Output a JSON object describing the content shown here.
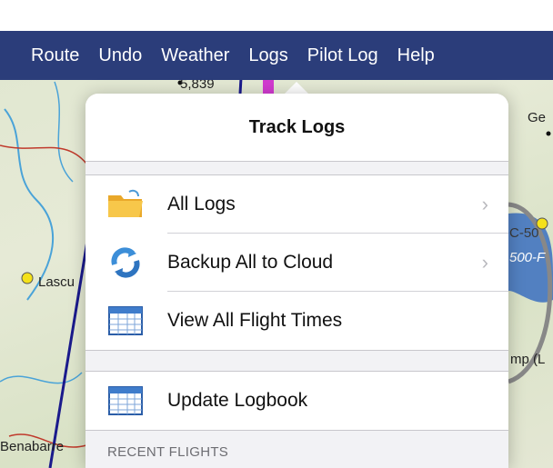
{
  "toolbar": {
    "items": [
      "Route",
      "Undo",
      "Weather",
      "Logs",
      "Pilot Log",
      "Help"
    ]
  },
  "map": {
    "labels": {
      "elevation": "5,839",
      "lascu": "Lascu",
      "benabarre": "Benabarre",
      "ge": "Ge",
      "c50": "C-50",
      "f500": "500-F",
      "mp": "mp (L"
    }
  },
  "popover": {
    "title": "Track Logs",
    "items": [
      {
        "label": "All Logs",
        "icon": "folder-icon",
        "chevron": "›"
      },
      {
        "label": "Backup All to Cloud",
        "icon": "cloud-sync-icon",
        "chevron": "›"
      },
      {
        "label": "View All Flight Times",
        "icon": "table-icon",
        "chevron": ""
      }
    ],
    "items2": [
      {
        "label": "Update Logbook",
        "icon": "table-icon"
      }
    ],
    "section_header": "RECENT FLIGHTS"
  },
  "colors": {
    "nav_bar": "#2b3d7a",
    "route_line": "#1a1a8c",
    "airspace": "#3a6fc0",
    "magenta": "#d23bd0"
  }
}
